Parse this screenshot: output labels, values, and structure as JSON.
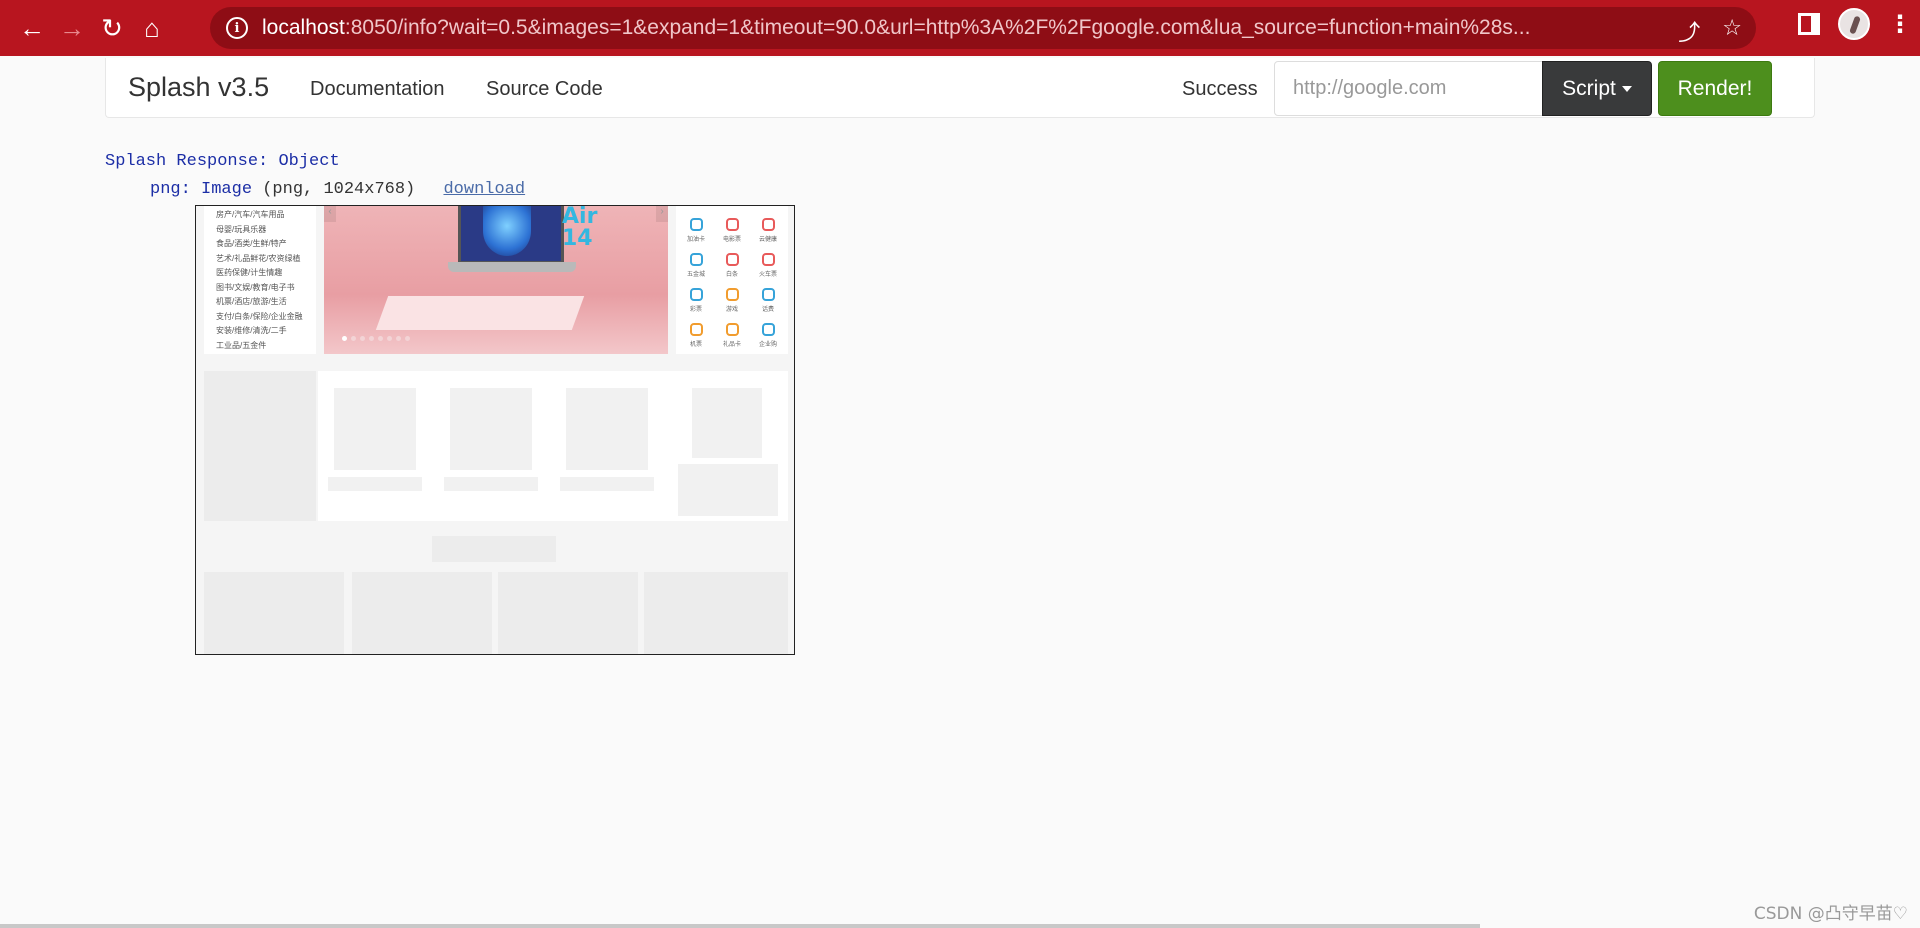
{
  "browser": {
    "url_host": "localhost",
    "url_rest": ":8050/info?wait=0.5&images=1&expand=1&timeout=90.0&url=http%3A%2F%2Fgoogle.com&lua_source=function+main%28s..."
  },
  "navbar": {
    "brand": "Splash v3.5",
    "links": [
      "Documentation",
      "Source Code"
    ],
    "status": "Success",
    "url_placeholder": "http://google.com",
    "script_label": "Script",
    "render_label": "Render!"
  },
  "response": {
    "title_key": "Splash Response:",
    "title_type": "Object",
    "png_key": "png:",
    "png_type": "Image",
    "png_meta": "(png, 1024x768)",
    "download_label": "download"
  },
  "preview": {
    "categories": [
      "房产/汽车/汽车用品",
      "母婴/玩具乐器",
      "食品/酒类/生鲜/特产",
      "艺术/礼品鲜花/农资绿植",
      "医药保健/计生情趣",
      "图书/文娱/教育/电子书",
      "机票/酒店/旅游/生活",
      "支付/白条/保险/企业金融",
      "安装/维修/清洗/二手",
      "工业品/五金件"
    ],
    "banner_text": "Air 14",
    "services": [
      {
        "label": "加油卡",
        "color": "blue"
      },
      {
        "label": "电影票",
        "color": "red"
      },
      {
        "label": "云健康",
        "color": "red"
      },
      {
        "label": "五金城",
        "color": "blue"
      },
      {
        "label": "白条",
        "color": "red"
      },
      {
        "label": "火车票",
        "color": "red"
      },
      {
        "label": "彩票",
        "color": "blue"
      },
      {
        "label": "游戏",
        "color": "orange"
      },
      {
        "label": "话费",
        "color": "blue"
      },
      {
        "label": "机票",
        "color": "orange"
      },
      {
        "label": "礼品卡",
        "color": "orange"
      },
      {
        "label": "企业购",
        "color": "blue"
      }
    ]
  },
  "watermark": "CSDN @凸守早苗♡"
}
